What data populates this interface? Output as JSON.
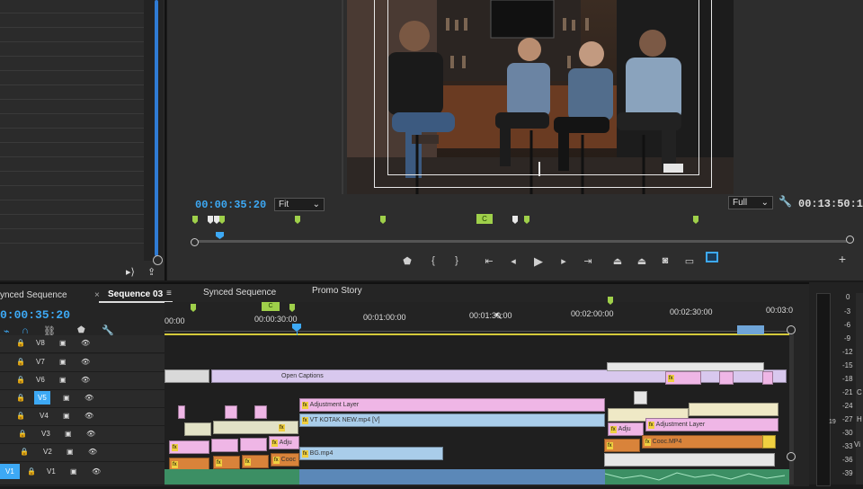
{
  "program_monitor": {
    "timecode_current": "00:00:35:20",
    "fit_select": "Fit",
    "resolution_select": "Full",
    "timecode_duration": "00:13:50:18",
    "marker_label": "C"
  },
  "timeline": {
    "tabs": {
      "synced_left": "ynced Sequence",
      "sequence03": "Sequence 03",
      "synced": "Synced Sequence",
      "promo": "Promo Story"
    },
    "timecode": "0:00:35:20",
    "ruler": [
      "00:00",
      "00:00:30:00",
      "00:01:00:00",
      "00:01:30:00",
      "00:02:00:00",
      "00:02:30:00",
      "00:03:0"
    ],
    "marker_label": "C",
    "tracks": [
      {
        "name": "V8"
      },
      {
        "name": "V7"
      },
      {
        "name": "V6"
      },
      {
        "name": "V5"
      },
      {
        "name": "V4"
      },
      {
        "name": "V3"
      },
      {
        "name": "V2"
      },
      {
        "name": "V1",
        "source": "V1"
      }
    ],
    "clips": {
      "captions": "Open Captions",
      "adjustment1": "Adjustment Layer",
      "vt": "VT KOTAK NEW.mp4 [V]",
      "adju_small": "Adju",
      "adjustment2": "Adjustment Layer",
      "adju_v2": "Adju",
      "coo": "Cooc",
      "cooc_mp4": "Cooc.MP4",
      "bg": "BG.mp4"
    }
  },
  "meter": {
    "labels": [
      "0",
      "-3",
      "-6",
      "-9",
      "-12",
      "-15",
      "-18",
      "-21",
      "-24",
      "-27",
      "-30",
      "-33",
      "-36",
      "-39"
    ]
  },
  "right_edge": {
    "labels": [
      "C",
      "H",
      "Vi"
    ],
    "label_19": "19"
  },
  "colors": {
    "accent": "#2f7bd4",
    "timecode": "#3da9f5",
    "marker": "#9fd04a",
    "playhead": "#3da9f5"
  }
}
